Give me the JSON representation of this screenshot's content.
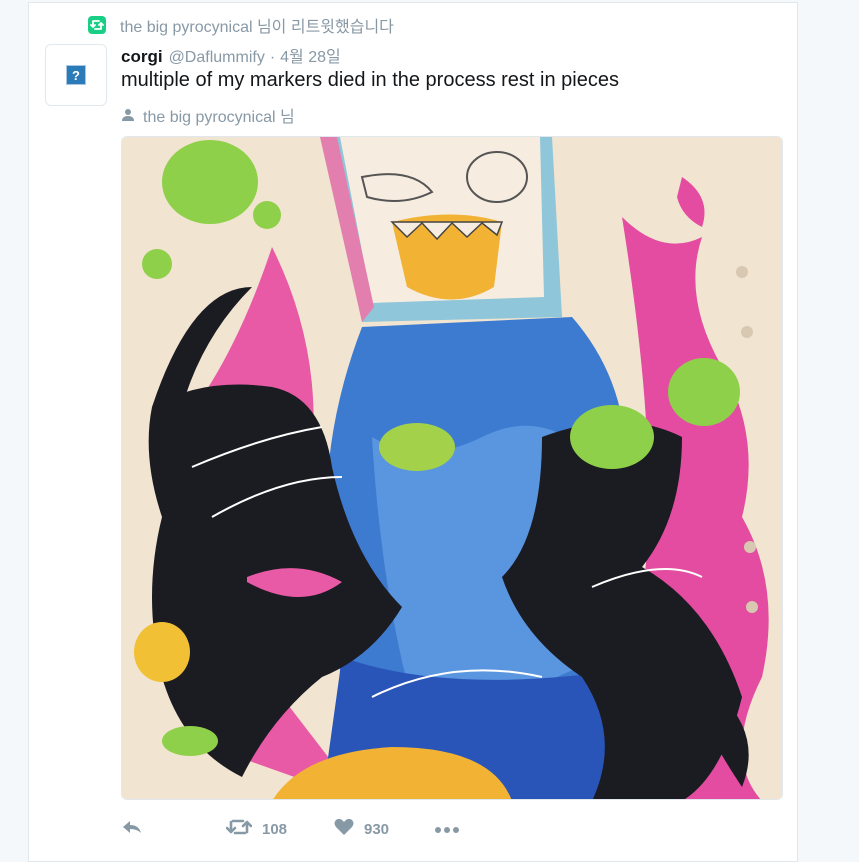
{
  "retweet_context": {
    "icon": "retweet-icon",
    "text": "the big pyrocynical 님이 리트윗했습니다"
  },
  "tweet": {
    "name": "corgi",
    "handle": "@Daflummify",
    "separator": "·",
    "date": "4월 28일",
    "text": "multiple of my markers died in the process rest in pieces",
    "context_icon": "person-icon",
    "context_text": "the big pyrocynical 님",
    "avatar_placeholder": "?"
  },
  "actions": {
    "reply_icon": "reply-icon",
    "retweet_icon": "retweet-icon",
    "retweet_count": "108",
    "like_icon": "heart-icon",
    "like_count": "930",
    "more_icon": "more-icon"
  },
  "colors": {
    "retweet_green": "#19cf86",
    "text_gray": "#8899a6",
    "text_dark": "#14171a",
    "border": "#e1e8ed"
  }
}
